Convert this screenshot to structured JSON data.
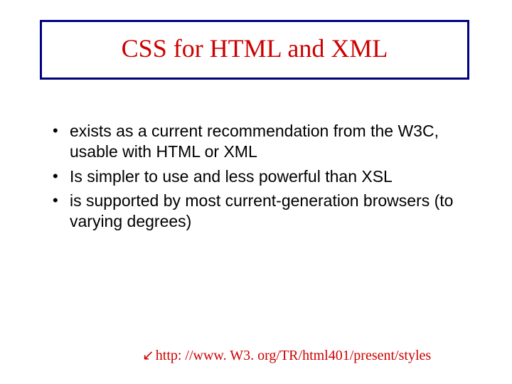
{
  "title": "CSS for HTML and XML",
  "bullets": [
    "exists as a current recommendation from the W3C, usable with HTML or XML",
    "Is simpler to use and less powerful than XSL",
    "is supported by most current-generation browsers (to varying degrees)"
  ],
  "footer": {
    "arrow": "↙",
    "url": "http: //www. W3. org/TR/html401/present/styles"
  }
}
